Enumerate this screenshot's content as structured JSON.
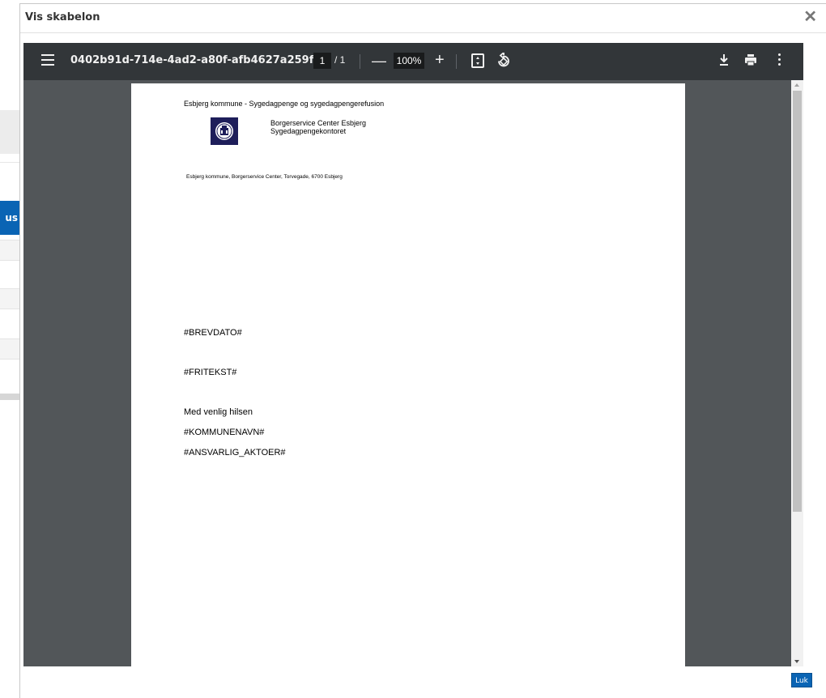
{
  "background": {
    "blue_item_label": "us"
  },
  "modal": {
    "title": "Vis skabelon",
    "close_glyph": "✕",
    "close_label": "Luk"
  },
  "viewer": {
    "filename": "0402b91d-714e-4ad2-a80f-afb4627a259f",
    "current_page": "1",
    "page_separator": "/ 1",
    "zoom": "100%",
    "icons": [
      "menu-icon",
      "zoom-out-icon",
      "zoom-in-icon",
      "fit-page-icon",
      "rotate-icon",
      "download-icon",
      "print-icon",
      "more-options-icon"
    ]
  },
  "document": {
    "header": "Esbjerg kommune  - Sygedagpenge og sygedagpengerefusion",
    "org_line1": "Borgerservice Center Esbjerg",
    "org_line2": "Sygedagpengekontoret",
    "address": "Esbjerg kommune, Borgerservice Center, Torvegade, 6700 Esbjerg",
    "date_field": "#BREVDATO#",
    "freetext_field": "#FRITEKST#",
    "closing": "Med venlig hilsen",
    "municipality_field": "#KOMMUNENAVN#",
    "responsible_field": "#ANSVARLIG_AKTOER#"
  },
  "colors": {
    "toolbar": "#323639",
    "viewer_bg": "#525659",
    "accent_blue": "#0a64b4",
    "logo_bg": "#1e1e5a"
  }
}
